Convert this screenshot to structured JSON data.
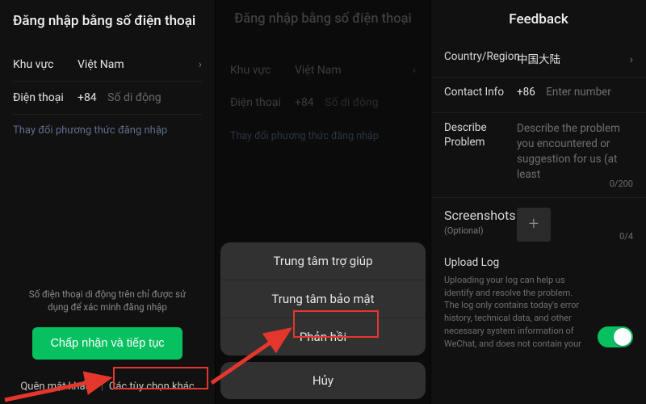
{
  "colors": {
    "accent": "#07c160",
    "annotation": "#e3362d"
  },
  "panel1": {
    "title": "Đăng nhập bằng số điện thoại",
    "region_label": "Khu vực",
    "region_value": "Việt Nam",
    "phone_label": "Điện thoại",
    "phone_prefix": "+84",
    "phone_placeholder": "Số di động",
    "switch_method": "Thay đổi phương thức đăng nhập",
    "disclaimer": "Số điện thoại di động trên chỉ được sử dụng để xác minh đăng nhập",
    "cta": "Chấp nhận và tiếp tục",
    "forgot": "Quên mật khẩu?",
    "more": "Các tùy chọn khác"
  },
  "panel2": {
    "title": "Đăng nhập bằng số điện thoại",
    "region_label": "Khu vực",
    "region_value": "Việt Nam",
    "phone_label": "Điện thoại",
    "phone_prefix": "+84",
    "phone_placeholder": "Số di động",
    "switch_method": "Thay đổi phương thức đăng nhập",
    "sheet": {
      "help": "Trung tâm trợ giúp",
      "security": "Trung tâm bảo mật",
      "feedback": "Phản hồi",
      "cancel": "Hủy"
    }
  },
  "panel3": {
    "title": "Feedback",
    "region_label": "Country/Region",
    "region_value": "中国大陆",
    "contact_label": "Contact Info",
    "contact_prefix": "+86",
    "contact_placeholder": "Enter number",
    "describe_label": "Describe Problem",
    "describe_placeholder": "Describe the problem you encountered or suggestion for us (at least",
    "describe_counter": "0/200",
    "screenshots_label": "Screenshots",
    "screenshots_optional": "(Optional)",
    "screenshots_counter": "0/4",
    "upload_label": "Upload Log",
    "upload_desc": "Uploading your log can help us identify and resolve the problem. The log only contains today's error history, technical data, and other necessary system information of WeChat, and does not contain your",
    "toggle_on": true
  }
}
